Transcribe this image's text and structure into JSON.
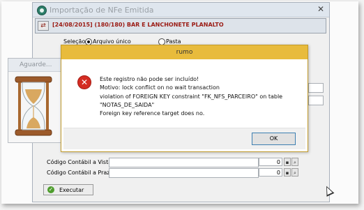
{
  "main_window": {
    "title": "Importação de NFe Emitida",
    "close_glyph": "✕",
    "header": "[24/08/2015] (180/180) BAR E LANCHONETE PLANALTO",
    "selection": {
      "label": "Seleção",
      "options": [
        "Arquivo único",
        "Pasta"
      ],
      "selected": "Arquivo único"
    },
    "fields": [
      {
        "label": "Código Contábil a Vista",
        "value": "0"
      },
      {
        "label": "Código Contábil a Prazo",
        "value": "0"
      }
    ],
    "execute_button": "Executar"
  },
  "waiting_window": {
    "title": "Aguarde..."
  },
  "dialog": {
    "title": "rumo",
    "message_lines": [
      "Este registro não pode ser incluído!",
      "Motivo: lock conflict on no wait transaction",
      "violation of FOREIGN KEY constraint \"FK_NFS_PARCEIRO\" on table",
      "\"NOTAS_DE_SAIDA\"",
      "Foreign key reference target does no."
    ],
    "ok_button": "OK"
  },
  "colors": {
    "dialog_titlebar": "#e8bb3c",
    "header_text": "#9b1b14",
    "error_icon": "#d42c22"
  }
}
